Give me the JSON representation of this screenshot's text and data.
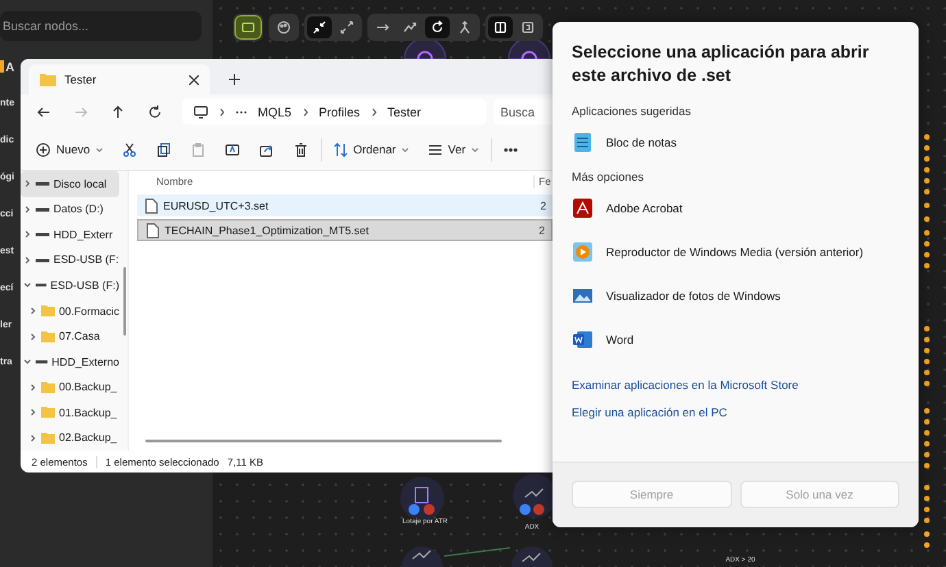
{
  "app": {
    "search": {
      "placeholder": "Buscar nodos..."
    },
    "sidebar_labels": [
      "A",
      "nte",
      "dic",
      "ógi",
      "cci",
      "est",
      "ecí",
      "ler",
      "tra"
    ],
    "toolbar_groups": [
      {
        "buttons": [
          {
            "kind": "frame",
            "selected": true
          }
        ]
      },
      {
        "buttons": [
          {
            "kind": "palette",
            "selected": false
          }
        ]
      },
      {
        "buttons": [
          {
            "kind": "collapse",
            "selected": true
          },
          {
            "kind": "expand",
            "selected": false
          }
        ]
      },
      {
        "buttons": [
          {
            "kind": "straight",
            "selected": false
          },
          {
            "kind": "curve",
            "selected": false
          },
          {
            "kind": "loop",
            "selected": true
          },
          {
            "kind": "merge",
            "selected": false
          }
        ]
      },
      {
        "buttons": [
          {
            "kind": "panel",
            "selected": true
          },
          {
            "kind": "panel-alt",
            "selected": false
          }
        ]
      }
    ],
    "nodes": [
      {
        "label": "Lotaje por ATR"
      },
      {
        "label": "ADX"
      },
      {
        "label": "ADX > 20"
      }
    ]
  },
  "explorer": {
    "tab": {
      "title": "Tester"
    },
    "breadcrumb": [
      "MQL5",
      "Profiles",
      "Tester"
    ],
    "search": {
      "placeholder": "Busca"
    },
    "nav_buttons": [
      {
        "kind": "back",
        "disabled": false
      },
      {
        "kind": "forward",
        "disabled": true
      },
      {
        "kind": "up",
        "disabled": false
      },
      {
        "kind": "refresh",
        "disabled": false
      }
    ],
    "commands": [
      {
        "kind": "new",
        "label": "Nuevo",
        "disabled": false
      },
      {
        "kind": "cut",
        "disabled": false
      },
      {
        "kind": "copy",
        "disabled": false
      },
      {
        "kind": "paste",
        "disabled": true
      },
      {
        "kind": "rename",
        "disabled": false
      },
      {
        "kind": "share",
        "disabled": false
      },
      {
        "kind": "delete",
        "disabled": false
      },
      {
        "kind": "sort",
        "label": "Ordenar",
        "disabled": false
      },
      {
        "kind": "view",
        "label": "Ver",
        "disabled": false
      },
      {
        "kind": "more",
        "disabled": false
      }
    ],
    "tree": [
      {
        "label": "Disco local",
        "kind": "drive",
        "selected": true,
        "expanded": false
      },
      {
        "label": "Datos (D:)",
        "kind": "drive",
        "selected": false,
        "expanded": false
      },
      {
        "label": "HDD_Exterr",
        "kind": "drive",
        "selected": false,
        "expanded": false
      },
      {
        "label": "ESD-USB (F:",
        "kind": "drive",
        "selected": false,
        "expanded": false
      },
      {
        "label": "ESD-USB (F:)",
        "kind": "drive",
        "selected": false,
        "expanded": true,
        "children": [
          {
            "label": "00.Formacic",
            "kind": "folder",
            "selected": false,
            "expanded": false
          },
          {
            "label": "07.Casa",
            "kind": "folder",
            "selected": false,
            "expanded": false
          }
        ]
      },
      {
        "label": "HDD_Externo",
        "kind": "drive",
        "selected": false,
        "expanded": true,
        "children": [
          {
            "label": "00.Backup_",
            "kind": "folder",
            "selected": false,
            "expanded": false
          },
          {
            "label": "01.Backup_",
            "kind": "folder",
            "selected": false,
            "expanded": false
          },
          {
            "label": "02.Backup_",
            "kind": "folder",
            "selected": false,
            "expanded": false
          }
        ]
      }
    ],
    "columns": [
      "Nombre",
      "Fe"
    ],
    "files": [
      {
        "name": "EURUSD_UTC+3.set",
        "date": "2",
        "selected": false,
        "hovered": true
      },
      {
        "name": "TECHAIN_Phase1_Optimization_MT5.set",
        "date": "2",
        "selected": true,
        "hovered": false
      }
    ],
    "status_bar": [
      "2 elementos",
      "1 elemento seleccionado",
      "7,11 KB"
    ]
  },
  "dialog": {
    "title": "Seleccione una aplicación para abrir este archivo de .set",
    "sections": [
      {
        "heading": "Aplicaciones sugeridas",
        "apps": [
          {
            "kind": "notepad",
            "name": "Bloc de notas"
          }
        ]
      },
      {
        "heading": "Más opciones",
        "apps": [
          {
            "kind": "acrobat",
            "name": "Adobe Acrobat"
          },
          {
            "kind": "mediaplayer",
            "name": "Reproductor de Windows Media (versión anterior)"
          },
          {
            "kind": "photos",
            "name": "Visualizador de fotos de Windows"
          },
          {
            "kind": "word",
            "name": "Word"
          }
        ]
      }
    ],
    "links": [
      "Examinar aplicaciones en la Microsoft Store",
      "Elegir una aplicación en el PC"
    ],
    "buttons": [
      {
        "label": "Siempre",
        "disabled": true
      },
      {
        "label": "Solo una vez",
        "disabled": true
      }
    ]
  }
}
